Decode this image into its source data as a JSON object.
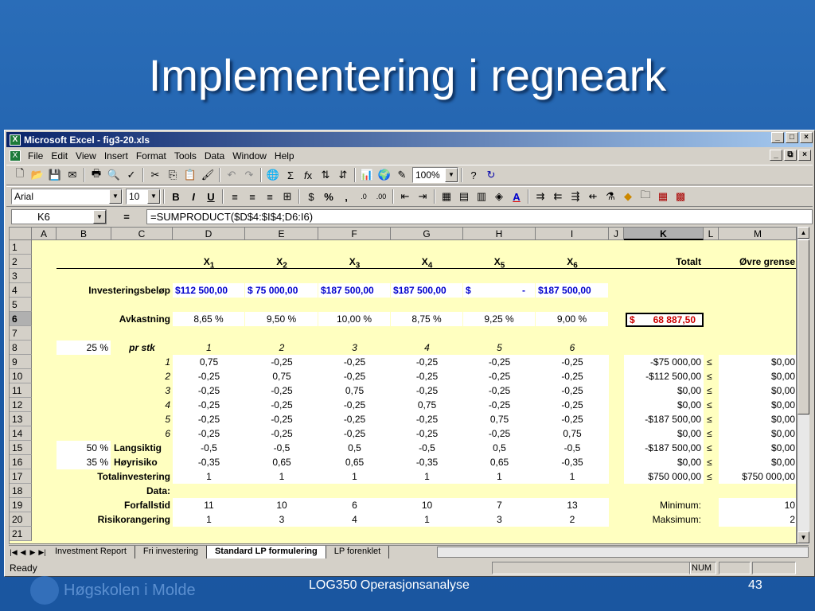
{
  "slide": {
    "title": "Implementering i regneark",
    "course": "LOG350 Operasjonsanalyse",
    "page": "43",
    "logo_text": "Høgskolen i Molde"
  },
  "window": {
    "title": "Microsoft Excel - fig3-20.xls"
  },
  "menu": [
    "File",
    "Edit",
    "View",
    "Insert",
    "Format",
    "Tools",
    "Data",
    "Window",
    "Help"
  ],
  "toolbar": {
    "zoom": "100%",
    "font": "Arial",
    "size": "10"
  },
  "formula_bar": {
    "cell": "K6",
    "eq": "=",
    "formula": "=SUMPRODUCT($D$4:$I$4;D6:I6)"
  },
  "columns": [
    "A",
    "B",
    "C",
    "D",
    "E",
    "F",
    "G",
    "H",
    "I",
    "J",
    "K",
    "L",
    "M"
  ],
  "rows": [
    "1",
    "2",
    "3",
    "4",
    "5",
    "6",
    "7",
    "8",
    "9",
    "10",
    "11",
    "12",
    "13",
    "14",
    "15",
    "16",
    "17",
    "18",
    "19",
    "20",
    "21"
  ],
  "header_row": {
    "vars": [
      "X",
      "X",
      "X",
      "X",
      "X",
      "X"
    ],
    "subs": [
      "1",
      "2",
      "3",
      "4",
      "5",
      "6"
    ],
    "totalt": "Totalt",
    "ovre": "Øvre grense"
  },
  "invest": {
    "label": "Investeringsbeløp",
    "values": [
      "$112 500,00",
      "$  75 000,00",
      "$187 500,00",
      "$187 500,00",
      "$",
      "-",
      "$187 500,00"
    ]
  },
  "avk": {
    "label": "Avkastning",
    "values": [
      "8,65 %",
      "9,50 %",
      "10,00 %",
      "8,75 %",
      "9,25 %",
      "9,00 %"
    ],
    "total_dollar": "$",
    "total": "68 887,50"
  },
  "row8": {
    "b": "25 %",
    "c": "pr stk",
    "values": [
      "1",
      "2",
      "3",
      "4",
      "5",
      "6"
    ]
  },
  "matrix": [
    {
      "idx": "1",
      "vals": [
        "0,75",
        "-0,25",
        "-0,25",
        "-0,25",
        "-0,25",
        "-0,25"
      ],
      "k": "-$75 000,00",
      "l": "≤",
      "m": "$0,00"
    },
    {
      "idx": "2",
      "vals": [
        "-0,25",
        "0,75",
        "-0,25",
        "-0,25",
        "-0,25",
        "-0,25"
      ],
      "k": "-$112 500,00",
      "l": "≤",
      "m": "$0,00"
    },
    {
      "idx": "3",
      "vals": [
        "-0,25",
        "-0,25",
        "0,75",
        "-0,25",
        "-0,25",
        "-0,25"
      ],
      "k": "$0,00",
      "l": "≤",
      "m": "$0,00"
    },
    {
      "idx": "4",
      "vals": [
        "-0,25",
        "-0,25",
        "-0,25",
        "0,75",
        "-0,25",
        "-0,25"
      ],
      "k": "$0,00",
      "l": "≤",
      "m": "$0,00"
    },
    {
      "idx": "5",
      "vals": [
        "-0,25",
        "-0,25",
        "-0,25",
        "-0,25",
        "0,75",
        "-0,25"
      ],
      "k": "-$187 500,00",
      "l": "≤",
      "m": "$0,00"
    },
    {
      "idx": "6",
      "vals": [
        "-0,25",
        "-0,25",
        "-0,25",
        "-0,25",
        "-0,25",
        "0,75"
      ],
      "k": "$0,00",
      "l": "≤",
      "m": "$0,00"
    }
  ],
  "row15": {
    "b": "50 %",
    "c": "Langsiktig",
    "vals": [
      "-0,5",
      "-0,5",
      "0,5",
      "-0,5",
      "0,5",
      "-0,5"
    ],
    "k": "-$187 500,00",
    "l": "≤",
    "m": "$0,00"
  },
  "row16": {
    "b": "35 %",
    "c": "Høyrisiko",
    "vals": [
      "-0,35",
      "0,65",
      "0,65",
      "-0,35",
      "0,65",
      "-0,35"
    ],
    "k": "$0,00",
    "l": "≤",
    "m": "$0,00"
  },
  "row17": {
    "c": "Totalinvestering",
    "vals": [
      "1",
      "1",
      "1",
      "1",
      "1",
      "1"
    ],
    "k": "$750 000,00",
    "l": "≤",
    "m": "$750 000,00"
  },
  "row18": {
    "c": "Data:"
  },
  "row19": {
    "c": "Forfallstid",
    "vals": [
      "11",
      "10",
      "6",
      "10",
      "7",
      "13"
    ],
    "k": "Minimum:",
    "m": "10"
  },
  "row20": {
    "c": "Risikorangering",
    "vals": [
      "1",
      "3",
      "4",
      "1",
      "3",
      "2"
    ],
    "k": "Maksimum:",
    "m": "2"
  },
  "tabs": [
    "Investment Report",
    "Fri investering",
    "Standard LP formulering",
    "LP forenklet"
  ],
  "status": {
    "left": "Ready",
    "num": "NUM"
  }
}
